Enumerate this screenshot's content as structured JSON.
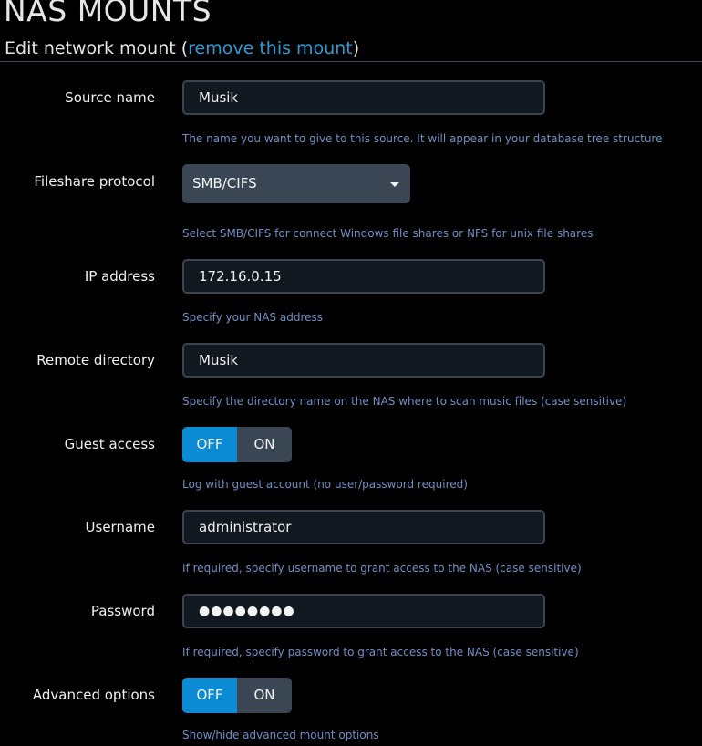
{
  "page_title": "NAS MOUNTS",
  "subheader": {
    "text_before": "Edit network mount (",
    "link": "remove this mount",
    "text_after": ")"
  },
  "source_name": {
    "label": "Source name",
    "value": "Musik",
    "help": "The name you want to give to this source. It will appear in your database tree structure"
  },
  "protocol": {
    "label": "Fileshare protocol",
    "selected": "SMB/CIFS",
    "help": "Select SMB/CIFS for connect Windows file shares or NFS for unix file shares"
  },
  "ip_address": {
    "label": "IP address",
    "value": "172.16.0.15",
    "help": "Specify your NAS address"
  },
  "remote_directory": {
    "label": "Remote directory",
    "value": "Musik",
    "help": "Specify the directory name on the NAS where to scan music files (case sensitive)"
  },
  "guest_access": {
    "label": "Guest access",
    "off_label": "OFF",
    "on_label": "ON",
    "state": "OFF",
    "help": "Log with guest account (no user/password required)"
  },
  "username": {
    "label": "Username",
    "value": "administrator",
    "help": "If required, specify username to grant access to the NAS (case sensitive)"
  },
  "password": {
    "label": "Password",
    "masked_value": "●●●●●●●●",
    "help": "If required, specify password to grant access to the NAS (case sensitive)"
  },
  "advanced_options": {
    "label": "Advanced options",
    "off_label": "OFF",
    "on_label": "ON",
    "state": "OFF",
    "help": "Show/hide advanced mount options"
  },
  "colors": {
    "background": "#000000",
    "accent": "#0a8bd3",
    "link": "#2c9bd4",
    "help_text": "#6f8fc4",
    "input_bg": "#121820",
    "control_bg": "#3a4654"
  }
}
